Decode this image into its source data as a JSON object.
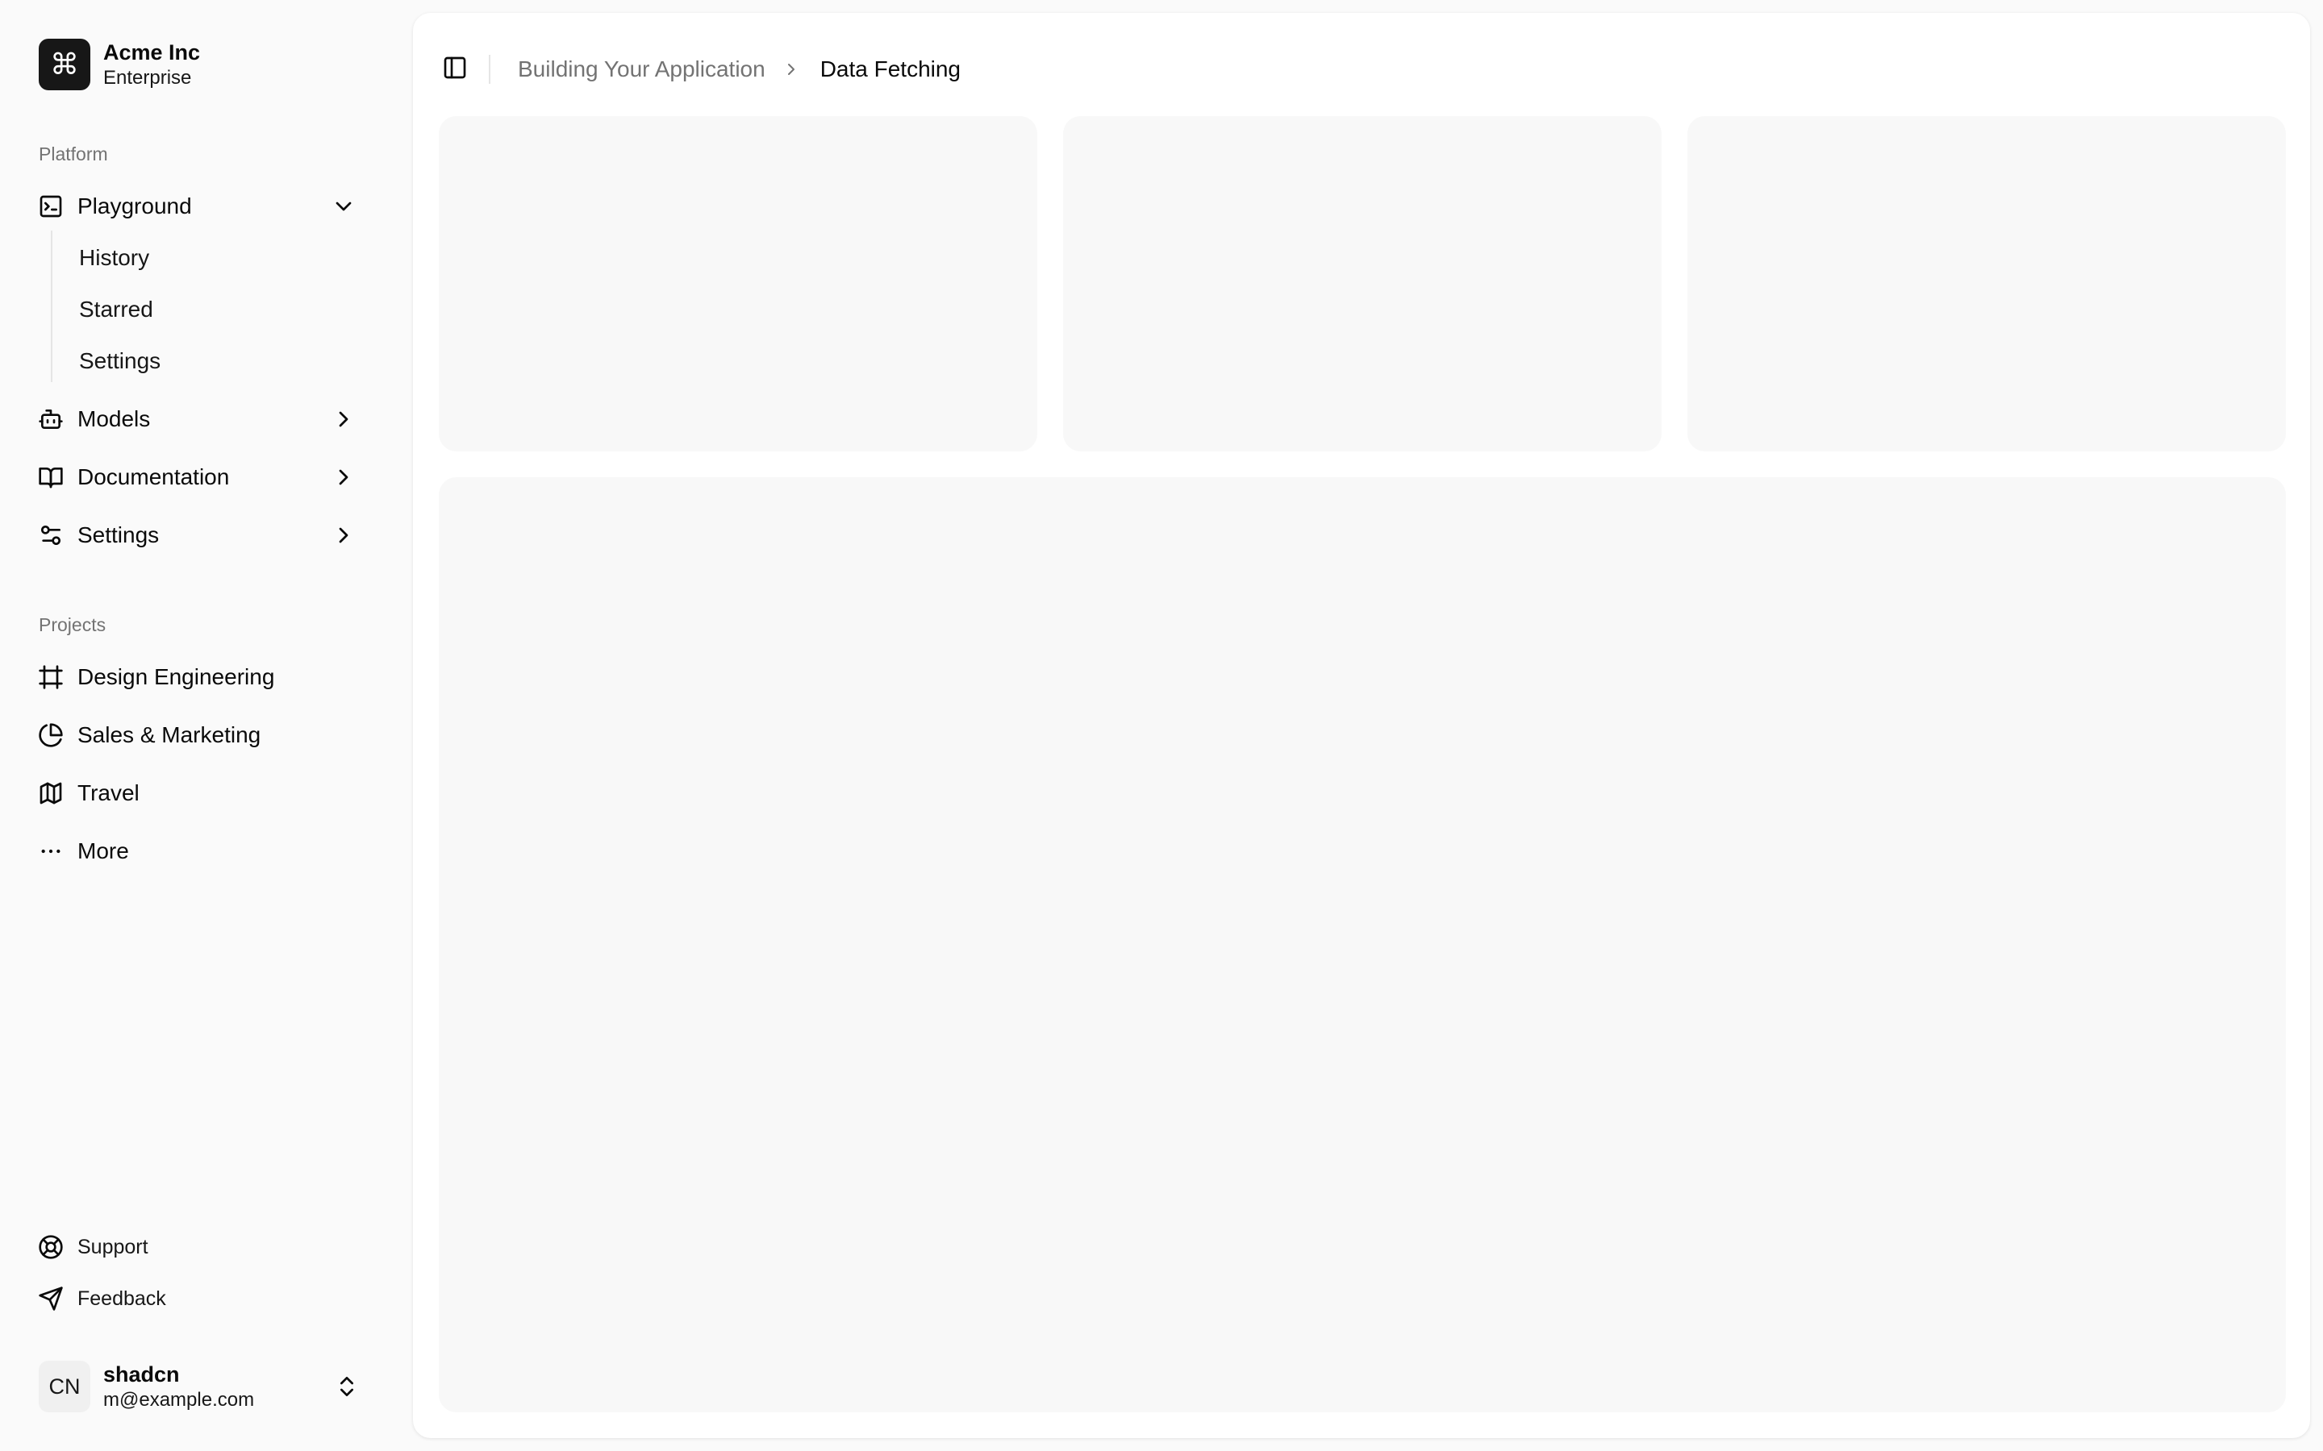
{
  "team": {
    "name": "Acme Inc",
    "plan": "Enterprise",
    "logo_glyph": "⌘"
  },
  "platform": {
    "label": "Platform",
    "items": [
      {
        "label": "Playground",
        "icon": "terminal-icon",
        "expanded": true,
        "subitems": [
          "History",
          "Starred",
          "Settings"
        ]
      },
      {
        "label": "Models",
        "icon": "bot-icon",
        "expanded": false
      },
      {
        "label": "Documentation",
        "icon": "book-open-icon",
        "expanded": false
      },
      {
        "label": "Settings",
        "icon": "settings-sliders-icon",
        "expanded": false
      }
    ]
  },
  "projects": {
    "label": "Projects",
    "items": [
      {
        "label": "Design Engineering",
        "icon": "frame-icon"
      },
      {
        "label": "Sales & Marketing",
        "icon": "pie-chart-icon"
      },
      {
        "label": "Travel",
        "icon": "map-icon"
      },
      {
        "label": "More",
        "icon": "more-horizontal-icon"
      }
    ]
  },
  "secondary": [
    {
      "label": "Support",
      "icon": "life-buoy-icon"
    },
    {
      "label": "Feedback",
      "icon": "send-icon"
    }
  ],
  "user": {
    "initials": "CN",
    "name": "shadcn",
    "email": "m@example.com"
  },
  "breadcrumb": {
    "parent": "Building Your Application",
    "current": "Data Fetching"
  },
  "colors": {
    "background": "#fafafa",
    "surface": "#ffffff",
    "placeholder": "#f8f8f8",
    "muted_text": "#737373",
    "brand": "#171717"
  }
}
